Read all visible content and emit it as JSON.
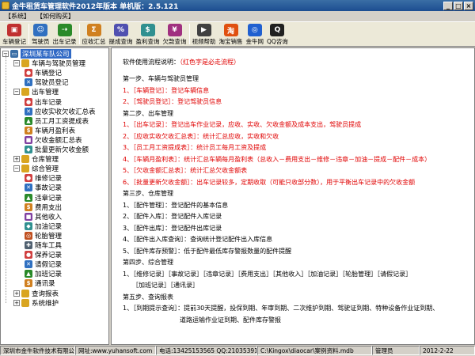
{
  "window": {
    "title": "金牛租赁车管理软件2012年版本  单机版：2.5.121",
    "minimize": "_",
    "maximize": "□",
    "close": "×"
  },
  "menu": [
    "【系统】",
    "【如何购买】"
  ],
  "toolbar": [
    {
      "label": "车辆登记",
      "icon": "car-icon",
      "color": "#c03030"
    },
    {
      "label": "驾驶员",
      "icon": "driver-icon",
      "color": "#3070c0"
    },
    {
      "label": "出车记录",
      "icon": "dispatch-icon",
      "color": "#2a8a2a"
    },
    {
      "label": "应收汇总",
      "icon": "receivable-icon",
      "color": "#d08020"
    },
    {
      "label": "提成查询",
      "icon": "commission-icon",
      "color": "#5050b0"
    },
    {
      "label": "盈利查询",
      "icon": "profit-icon",
      "color": "#309090"
    },
    {
      "label": "欠款查询",
      "icon": "debt-icon",
      "color": "#a03080"
    },
    {
      "label": "视频帮助",
      "icon": "video-icon",
      "color": "#404040"
    },
    {
      "label": "淘宝销售",
      "icon": "taobao-icon",
      "color": "#e05010"
    },
    {
      "label": "金牛网",
      "icon": "web-icon",
      "color": "#2060d0"
    },
    {
      "label": "QQ咨询",
      "icon": "qq-icon",
      "color": "#202020"
    }
  ],
  "tree": {
    "root": "深圳某车队公司",
    "groups": [
      {
        "label": "车辆与驾驶员管理",
        "expanded": true,
        "children": [
          "车辆登记",
          "驾驶员登记"
        ]
      },
      {
        "label": "出车管理",
        "expanded": true,
        "children": [
          "出车记录",
          "应收实收欠收汇总表",
          "员工月工资提成表",
          "车辆月盈利表",
          "欠收金额汇总表",
          "批量更新欠收金额"
        ]
      },
      {
        "label": "仓库管理",
        "expanded": false,
        "children": []
      },
      {
        "label": "综合管理",
        "expanded": true,
        "children": [
          "维修记录",
          "事故记录",
          "违章记录",
          "费用支出",
          "其他收入",
          "加油记录",
          "轮胎管理",
          "随车工具",
          "保养记录",
          "请假记录",
          "加班记录",
          "通讯录"
        ]
      },
      {
        "label": "查询报表",
        "expanded": false,
        "children": []
      },
      {
        "label": "系统维护",
        "expanded": false,
        "children": []
      }
    ]
  },
  "guide": {
    "intro": "软件使用流程说明：",
    "intro_note": "（红色字是必走流程）",
    "lines": [
      {
        "text": "第一步、车辆与驾驶员管理",
        "red": false
      },
      {
        "text": "1、［车辆登记］：登记车辆信息",
        "red": true
      },
      {
        "text": "2、［驾驶员登记］：登记驾驶员信息",
        "red": true
      },
      {
        "text": "第二步、出车管理",
        "red": false
      },
      {
        "text": "1、［出车记录］：登记出车作业记录，应收、实收、欠收金额及成本支出，驾驶员提成",
        "red": true
      },
      {
        "text": "2、［应收实收欠收汇总表］：统计汇总应收，实收和欠收",
        "red": true
      },
      {
        "text": "3、［员工月工资提成表］：统计员工每月工资及提成",
        "red": true
      },
      {
        "text": "4、［车辆月盈利表］：统计汇总车辆每月盈利表（总收入－费用支出－维修－违章－加油－提成－配件－成本）",
        "red": true
      },
      {
        "text": "5、［欠收金额汇总表］：统计汇总欠收金额表",
        "red": true
      },
      {
        "text": "6、［批量更新欠收金额］：出车记录较多，定期收取（可能只收部分数），用于平衡出车记录中的欠收金额",
        "red": true
      },
      {
        "text": "第三步、仓库管理",
        "red": false
      },
      {
        "text": "1、［配件管理］：登记配件的基本信息",
        "red": false
      },
      {
        "text": "2、［配件入库］：登记配件入库记录",
        "red": false
      },
      {
        "text": "3、［配件出库］：登记配件出库记录",
        "red": false
      },
      {
        "text": "4、［配件出入库查询］：查询统计登记配件出入库信息",
        "red": false
      },
      {
        "text": "5、［配件库存预警］：低于配件最低库存警报数量的配件提醒",
        "red": false
      },
      {
        "text": "第四步、综合管理",
        "red": false
      },
      {
        "text": "1、［维修记录］［事故记录］［违章记录］［费用支出］［其他收入］［加油记录］［轮胎管理］［请假记录］",
        "red": false
      },
      {
        "text": "　　［加班记录］［通讯录］",
        "red": false
      },
      {
        "text": "第五步、查询报表",
        "red": false
      },
      {
        "text": "1、［到期提示查询］：提前30天提醒，投保到期、年审到期、二次维护到期、驾驶证到期、特种设备作业证到期、",
        "red": false
      },
      {
        "text": "　　　　　　　　　道路运输作业证到期、配件库存警报",
        "red": false
      }
    ]
  },
  "status": {
    "company": "深圳市金牛软件技术有限公司",
    "website": "网址:www.yuhansoft.com",
    "phone": "电话:13425153565 QQ:21035391",
    "db_path": "C:\\Kingox\\diaocar\\案例资料.mdb",
    "user": "管理员",
    "date": "2012-2-22"
  }
}
